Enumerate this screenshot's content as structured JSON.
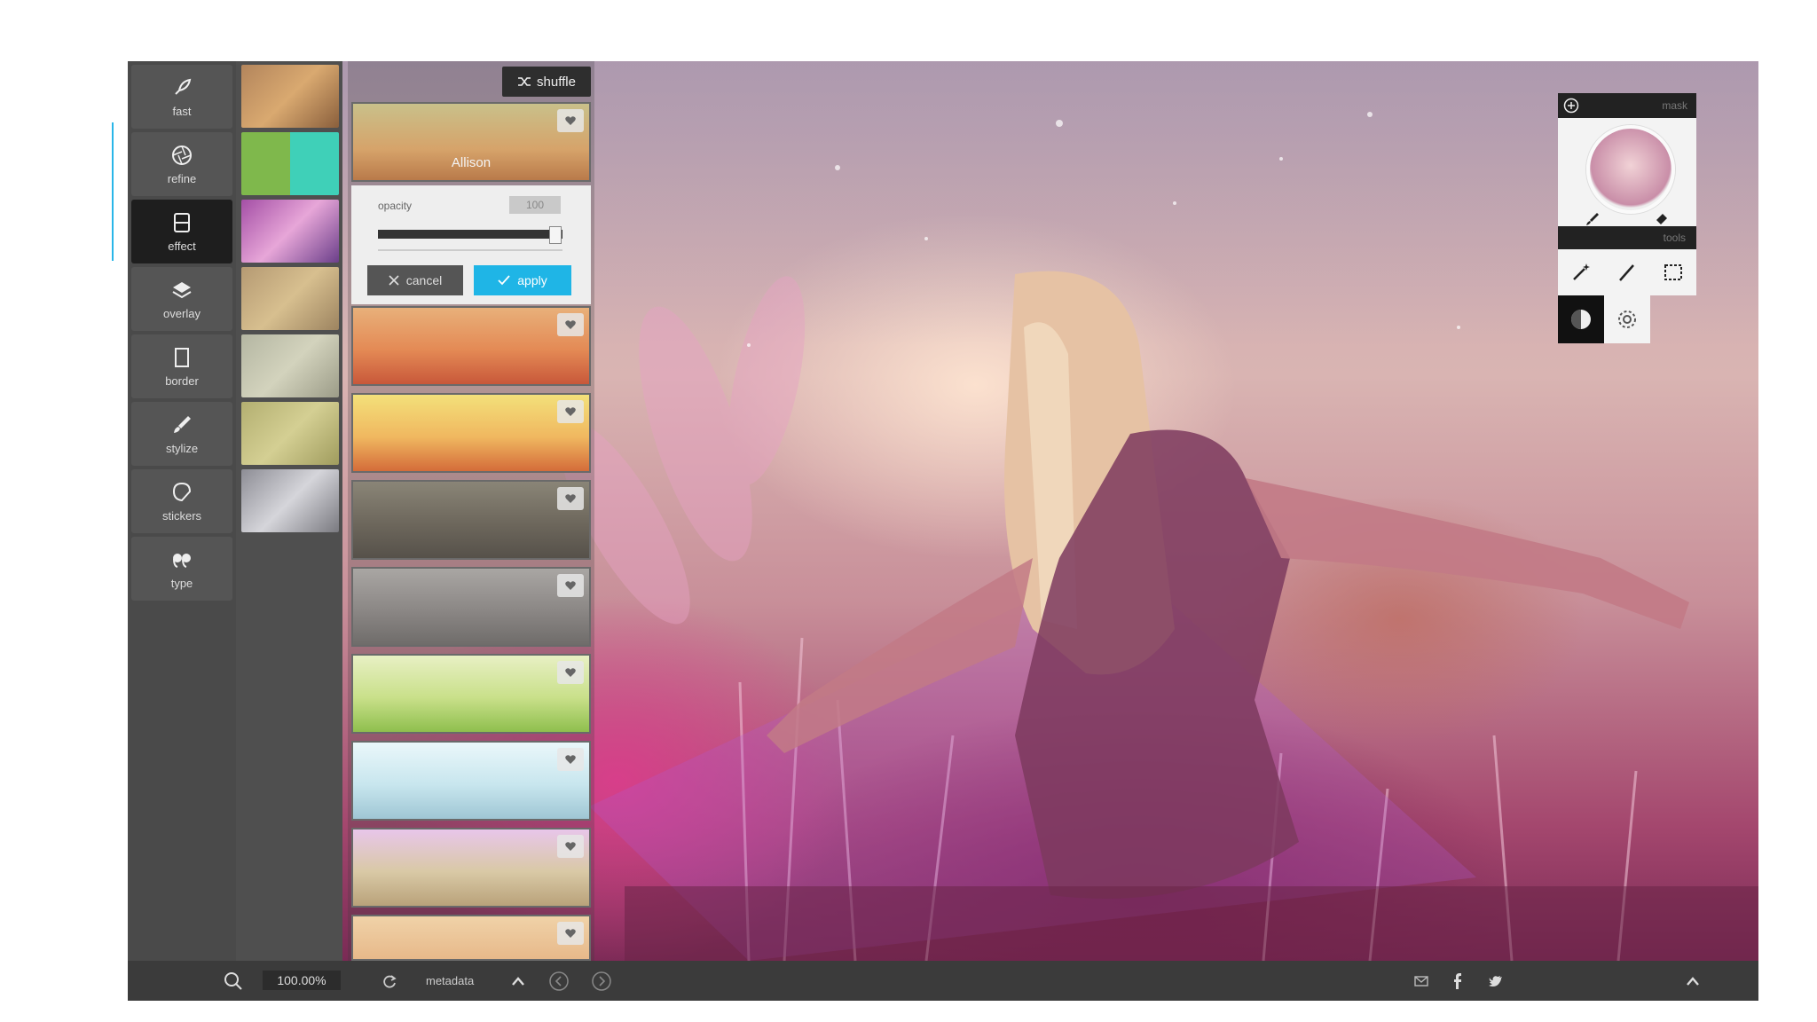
{
  "rail": {
    "items": [
      {
        "label": "fast",
        "icon": "rocket-icon"
      },
      {
        "label": "refine",
        "icon": "aperture-icon"
      },
      {
        "label": "effect",
        "icon": "film-icon",
        "active": true
      },
      {
        "label": "overlay",
        "icon": "layers-icon"
      },
      {
        "label": "border",
        "icon": "frame-icon"
      },
      {
        "label": "stylize",
        "icon": "brush-icon"
      },
      {
        "label": "stickers",
        "icon": "sticker-icon"
      },
      {
        "label": "type",
        "icon": "quote-icon"
      }
    ]
  },
  "filters": {
    "shuffle_label": "shuffle",
    "selected_name": "Allison",
    "settings": {
      "opacity_label": "opacity",
      "opacity_value": "100",
      "opacity_fraction": 0.96,
      "cancel_label": "cancel",
      "apply_label": "apply"
    }
  },
  "mask_panel": {
    "header_label": "mask",
    "tools_label": "tools"
  },
  "bottombar": {
    "zoom": "100.00%",
    "metadata_label": "metadata"
  },
  "colors": {
    "accent": "#1fb5e6",
    "rail_active": "#1e1e1e",
    "rail_bg": "#4a4a4a"
  }
}
